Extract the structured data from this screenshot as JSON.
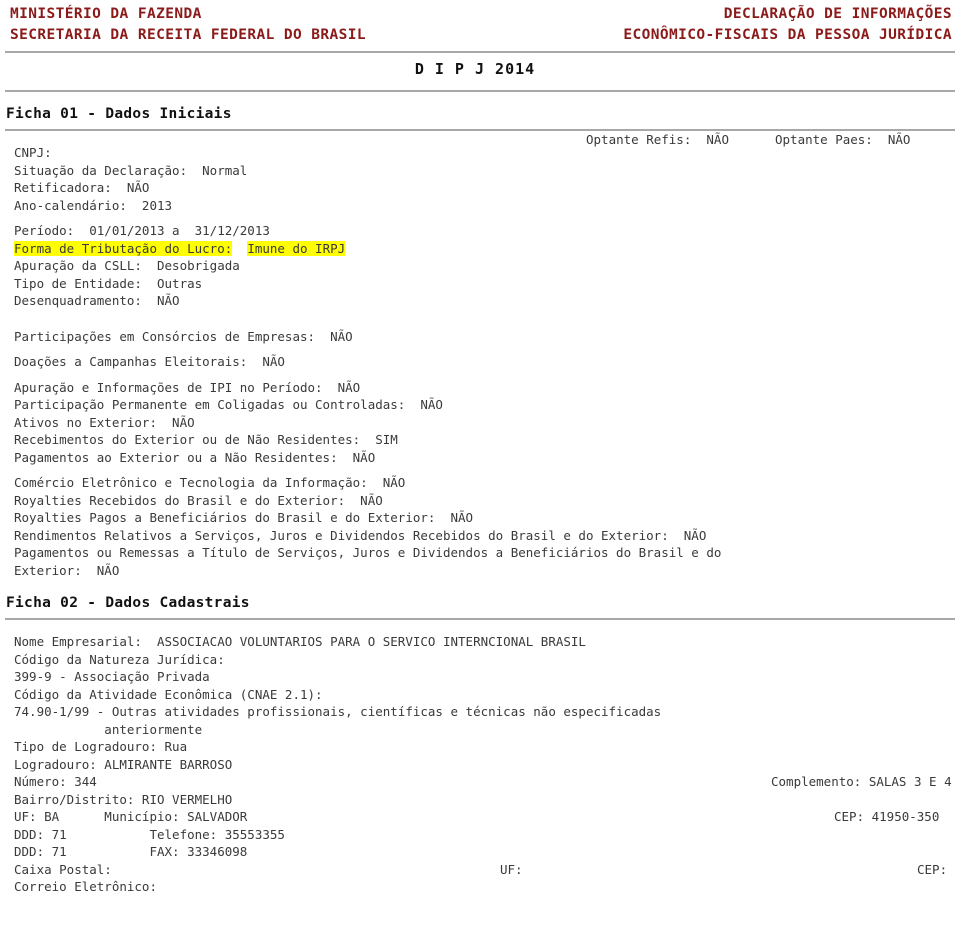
{
  "masthead": {
    "left_line1": "MINISTÉRIO DA FAZENDA",
    "left_line2": "SECRETARIA DA RECEITA FEDERAL DO BRASIL",
    "right_line1": "DECLARAÇÃO DE INFORMAÇÕES",
    "right_line2": "ECONÔMICO-FISCAIS DA PESSOA JURÍDICA",
    "title": "D I P J  2014",
    "accent_color": "#8b1a1a",
    "rule_color": "#a8a8a8"
  },
  "ficha01": {
    "heading": "Ficha 01 - Dados Iniciais",
    "cnpj": "CNPJ:",
    "situacao": "Situação da Declaração:  Normal",
    "retificadora": "Retificadora:  NÃO",
    "ano_calendario": "Ano-calendário:  2013",
    "optante_refis": "Optante Refis:  NÃO",
    "optante_paes": "Optante Paes:  NÃO",
    "periodo": "Período:  01/01/2013 a  31/12/2013",
    "forma_tributacao_label": "Forma de Tributação do Lucro:",
    "forma_tributacao_value": "Imune do IRPJ",
    "apuracao_csll": "Apuração da CSLL:  Desobrigada",
    "tipo_entidade": "Tipo de Entidade:  Outras",
    "desenquadramento": "Desenquadramento:  NÃO",
    "participacoes_consorcios": "Participações em Consórcios de Empresas:  NÃO",
    "doacoes_campanhas": "Doações a Campanhas Eleitorais:  NÃO",
    "apuracao_ipi": "Apuração e Informações de IPI no Período:  NÃO",
    "participacao_permanente": "Participação Permanente em Coligadas ou Controladas:  NÃO",
    "ativos_exterior": "Ativos no Exterior:  NÃO",
    "recebimentos_exterior": "Recebimentos do Exterior ou de Não Residentes:  SIM",
    "pagamentos_exterior": "Pagamentos ao Exterior ou a Não Residentes:  NÃO",
    "comercio_eletronico": "Comércio Eletrônico e Tecnologia da Informação:  NÃO",
    "royalties_recebidos": "Royalties Recebidos do Brasil e do Exterior:  NÃO",
    "royalties_pagos": "Royalties Pagos a Beneficiários do Brasil e do Exterior:  NÃO",
    "rendimentos_relativos": "Rendimentos Relativos a Serviços, Juros e Dividendos Recebidos do Brasil e do Exterior:  NÃO",
    "pagamentos_remessas_l1": "Pagamentos ou Remessas a Título de Serviços, Juros e Dividendos a Beneficiários do Brasil e do",
    "pagamentos_remessas_l2": "Exterior:  NÃO"
  },
  "ficha02": {
    "heading": "Ficha 02 - Dados Cadastrais",
    "nome_empresarial": "Nome Empresarial:  ASSOCIACAO VOLUNTARIOS PARA O SERVICO INTERNCIONAL BRASIL",
    "codigo_natureza_label": "Código da Natureza Jurídica:",
    "codigo_natureza_value": "399-9 - Associação Privada",
    "codigo_atividade_label": "Código da Atividade Econômica (CNAE 2.1):",
    "codigo_atividade_value_l1": "74.90-1/99 - Outras atividades profissionais, científicas e técnicas não especificadas",
    "codigo_atividade_value_l2": "            anteriormente",
    "tipo_logradouro": "Tipo de Logradouro: Rua",
    "logradouro": "Logradouro: ALMIRANTE BARROSO",
    "numero": "Número: 344",
    "complemento": "Complemento: SALAS 3 E 4",
    "bairro": "Bairro/Distrito: RIO VERMELHO",
    "uf_municipio": "UF: BA      Município: SALVADOR",
    "cep": "CEP: 41950-350",
    "ddd_telefone": "DDD: 71           Telefone: 35553355",
    "ddd_fax": "DDD: 71           FAX: 33346098",
    "caixa_postal": "Caixa Postal:",
    "uf_empty": "UF:",
    "cep_empty": "CEP:",
    "correio_eletronico": "Correio Eletrônico:"
  }
}
